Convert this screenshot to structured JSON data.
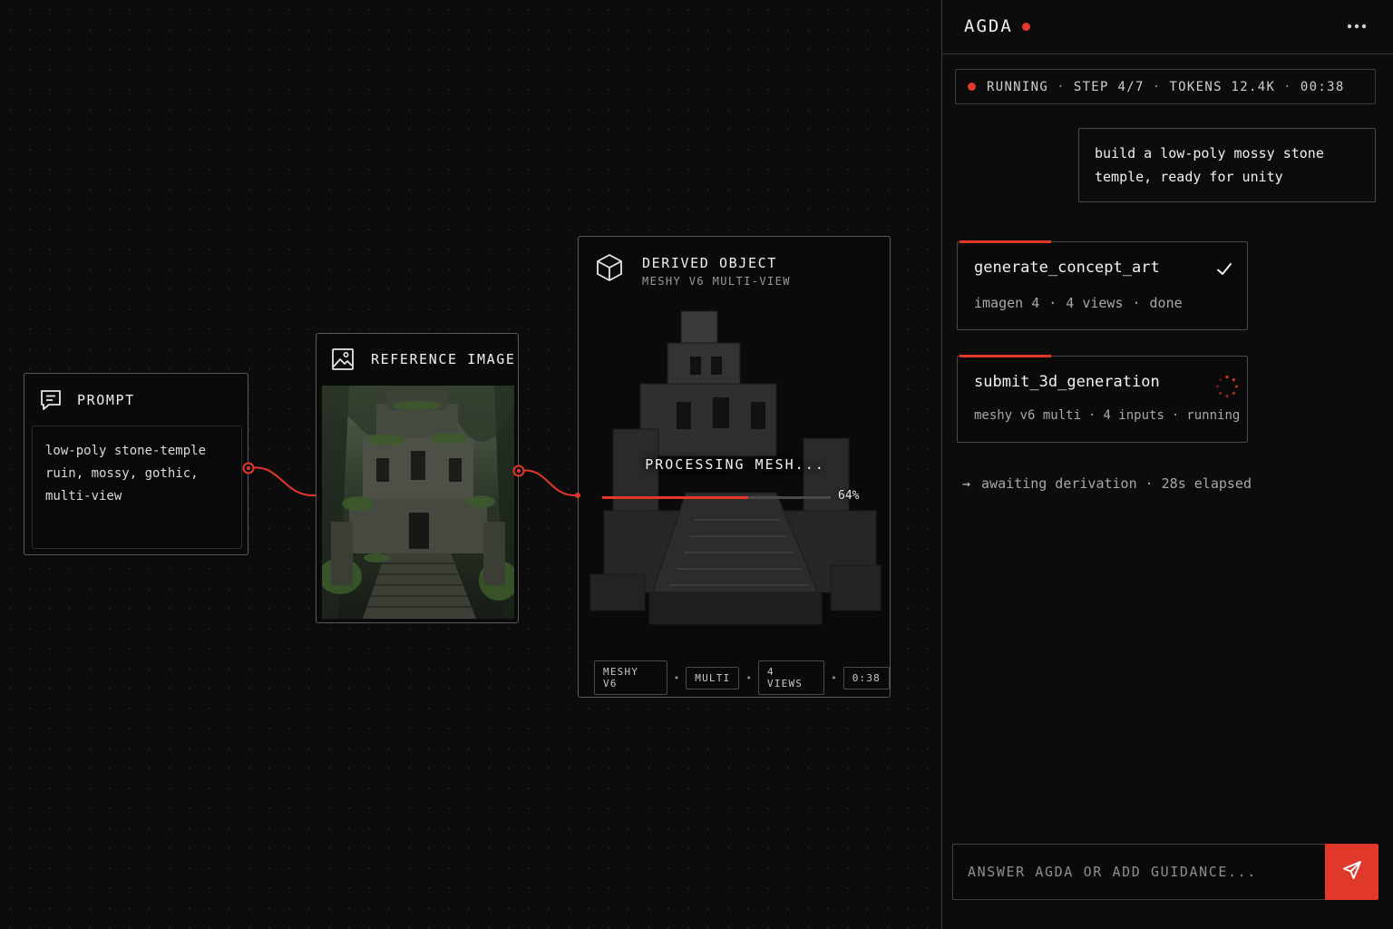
{
  "colors": {
    "accent": "#e2382b",
    "background": "#0b0b0b",
    "border": "#5a5a5a"
  },
  "canvas": {
    "prompt_node": {
      "title": "PROMPT",
      "icon": "chat-icon",
      "text": "low-poly stone-temple ruin, mossy, gothic, multi-view"
    },
    "reference_node": {
      "title": "REFERENCE IMAGE",
      "icon": "image-icon"
    },
    "derived_node": {
      "title": "DERIVED OBJECT",
      "subtitle": "MESHY V6 MULTI-VIEW",
      "icon": "cube-icon",
      "processing_label": "PROCESSING MESH...",
      "progress": 0.64,
      "progress_label": "64%",
      "tags": [
        "MESHY V6",
        "MULTI",
        "4 VIEWS",
        "0:38"
      ],
      "tag_separator": "•"
    }
  },
  "panel": {
    "brand": "AGDA",
    "menu_icon": "more-horizontal-icon",
    "status": {
      "state": "RUNNING",
      "step": "STEP 4/7",
      "tokens": "TOKENS 12.4K",
      "time": "00:38",
      "separator": "·"
    },
    "user_message": "build a low-poly mossy stone temple, ready for unity",
    "tasks": [
      {
        "name": "generate_concept_art",
        "meta": [
          "imagen 4",
          "4 views",
          "done"
        ],
        "state_icon": "check-icon"
      },
      {
        "name": "submit_3d_generation",
        "meta": [
          "meshy v6 multi",
          "4 inputs",
          "running"
        ],
        "state_icon": "spinner-icon"
      }
    ],
    "awaiting": {
      "arrow": "→",
      "text": "awaiting derivation",
      "elapsed": "28s elapsed"
    },
    "composer": {
      "placeholder": "ANSWER AGDA OR ADD GUIDANCE...",
      "send_icon": "send-icon"
    }
  }
}
